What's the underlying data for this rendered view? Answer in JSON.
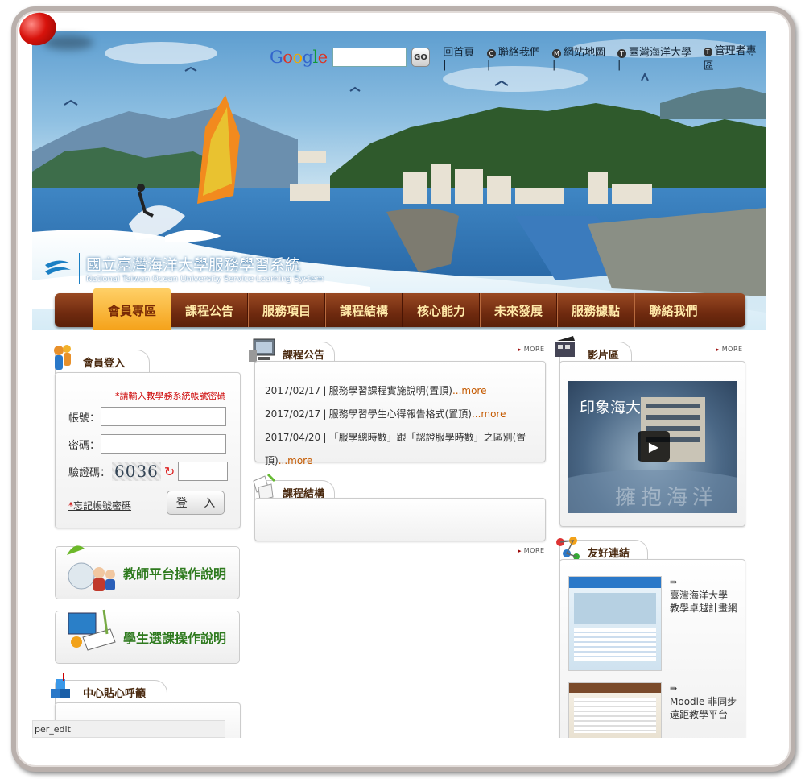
{
  "header": {
    "search_logo": "Google",
    "go_label": "GO",
    "links": [
      {
        "icon": "home-icon",
        "label": "回首頁"
      },
      {
        "icon": "c-bullet-icon",
        "label": "聯絡我們",
        "bullet": "C"
      },
      {
        "icon": "m-bullet-icon",
        "label": "網站地圖",
        "bullet": "M"
      },
      {
        "icon": "t-bullet-icon",
        "label": "臺灣海洋大學",
        "bullet": "T"
      },
      {
        "icon": "t-bullet-icon",
        "label": "管理者專區",
        "bullet": "T"
      }
    ],
    "site_title_zh": "國立臺灣海洋大學服務學習系統",
    "site_title_en": "National Taiwan Ocean University Service-Learning System"
  },
  "nav": [
    {
      "label": "會員專區",
      "active": true
    },
    {
      "label": "課程公告"
    },
    {
      "label": "服務項目"
    },
    {
      "label": "課程結構"
    },
    {
      "label": "核心能力"
    },
    {
      "label": "未來發展"
    },
    {
      "label": "服務據點"
    },
    {
      "label": "聯絡我們"
    }
  ],
  "login": {
    "title": "會員登入",
    "hint": "*請輸入教學務系統帳號密碼",
    "account_label": "帳號：",
    "password_label": "密碼：",
    "captcha_label": "驗證碼：",
    "captcha_value": "6036",
    "forgot": "忘記帳號密碼",
    "submit": "登 入"
  },
  "guides": {
    "teacher": "教師平台操作說明",
    "student": "學生選課操作說明"
  },
  "center": {
    "title": "中心貼心呼籲"
  },
  "announcements": {
    "title": "課程公告",
    "more": "MORE",
    "items": [
      {
        "date": "2017/02/17",
        "text": "服務學習課程實施說明(置頂)",
        "more": "...more"
      },
      {
        "date": "2017/02/17",
        "text": "服務學習學生心得報告格式(置頂)",
        "more": "...more"
      },
      {
        "date": "2017/04/20",
        "text": "「服學總時數」跟「認證服學時數」之區別(置頂)",
        "more": "...more"
      }
    ]
  },
  "structure": {
    "title": "課程結構",
    "more": "MORE"
  },
  "video": {
    "title": "影片區",
    "more": "MORE",
    "caption": "印象海大",
    "watermark": "擁抱海洋"
  },
  "links": {
    "title": "友好連結",
    "items": [
      {
        "line1": "臺灣海洋大學",
        "line2": "教學卓越計畫網"
      },
      {
        "line1": "Moodle 非同步",
        "line2": "遠距教學平台"
      }
    ]
  },
  "status_text": "per_edit"
}
